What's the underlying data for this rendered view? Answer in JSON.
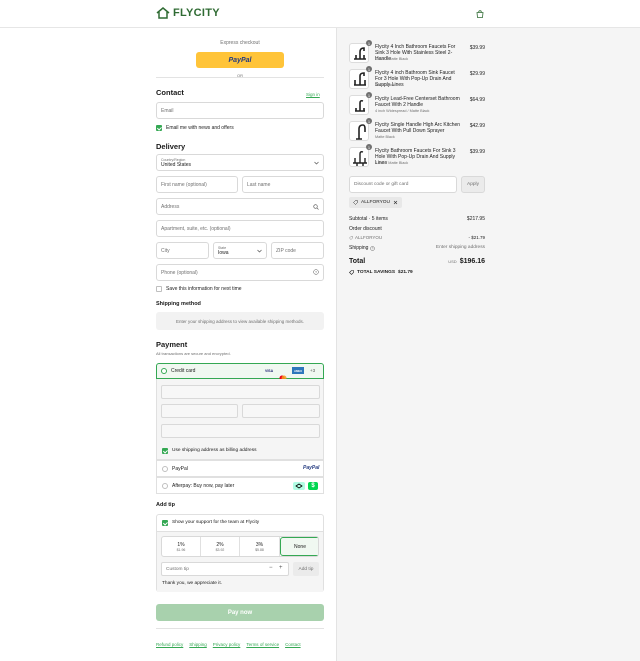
{
  "brand": {
    "name": "FLYCITY",
    "color": "#2f6b33",
    "accent": "#34a853"
  },
  "express": {
    "label": "Express checkout",
    "paypal_label": "PayPal",
    "or": "OR"
  },
  "contact": {
    "title": "Contact",
    "signin": "Sign in",
    "email_placeholder": "Email",
    "news_label": "Email me with news and offers",
    "news_checked": true
  },
  "delivery": {
    "title": "Delivery",
    "country_label": "Country/Region",
    "country_value": "United States",
    "first_name": "First name (optional)",
    "last_name": "Last name",
    "address": "Address",
    "apartment": "Apartment, suite, etc. (optional)",
    "city": "City",
    "state_label": "State",
    "state_value": "Iowa",
    "zip": "ZIP code",
    "phone": "Phone (optional)",
    "save_label": "Save this information for next time"
  },
  "shipping": {
    "title": "Shipping method",
    "message": "Enter your shipping address to view available shipping methods."
  },
  "payment": {
    "title": "Payment",
    "subtitle": "All transactions are secure and encrypted.",
    "credit_label": "Credit card",
    "cards": [
      "VISA",
      "MC",
      "AMEX"
    ],
    "more": "+3",
    "billing_label": "Use shipping address as billing address",
    "paypal_label": "PayPal",
    "paypal_logo": "PayPal",
    "afterpay_label": "Afterpay: Buy now, pay later"
  },
  "tip": {
    "title": "Add tip",
    "support_label": "Show your support for the team at Flycity",
    "options": [
      {
        "pct": "1%",
        "amt": "$1.96"
      },
      {
        "pct": "2%",
        "amt": "$3.92"
      },
      {
        "pct": "3%",
        "amt": "$5.88"
      }
    ],
    "none": "None",
    "custom_placeholder": "Custom tip",
    "minus": "−",
    "plus": "+",
    "add_label": "Add tip",
    "thanks": "Thank you, we appreciate it."
  },
  "pay_now": "Pay now",
  "footer": {
    "links": [
      "Refund policy",
      "Shipping",
      "Privacy policy",
      "Terms of service",
      "Contact"
    ]
  },
  "cart": {
    "items": [
      {
        "qty": "1",
        "name": "Flycity 4 Inch Bathroom Faucets For Sink 3 Hole With Stainless Steel 2-Handle",
        "variant": "4 inch / Matte Black",
        "price": "$39.99"
      },
      {
        "qty": "1",
        "name": "Flycity 4 inch Bathroom Sink Faucet For 3 Hole With Pop-Up Drain And Supply Lines",
        "variant": "Matte Black",
        "price": "$29.99"
      },
      {
        "qty": "1",
        "name": "Flycity Lead-Free Centerset Bathroom Faucet With 2 Handle",
        "variant": "4 inch Widespread / Matte Black",
        "price": "$64.99"
      },
      {
        "qty": "1",
        "name": "Flycity Single Handle High Arc Kitchen Faucet With Pull Down Sprayer",
        "variant": "Matte Black",
        "price": "$42.99"
      },
      {
        "qty": "1",
        "name": "Flycity Bathroom Faucets For Sink 3 Hole With Pop-Up Drain And Supply Lines",
        "variant": "4 inch / Matte Black",
        "price": "$39.99"
      }
    ],
    "discount_placeholder": "Discount code or gift card",
    "apply": "Apply",
    "code": "ALLFORYOU",
    "subtotal_label": "Subtotal · 5 items",
    "subtotal": "$217.95",
    "order_discount_label": "Order discount",
    "discount_code": "ALLFORYOU",
    "discount_amount": "- $21.79",
    "shipping_label": "Shipping",
    "shipping_value": "Enter shipping address",
    "total_label": "Total",
    "currency": "USD",
    "total": "$196.16",
    "savings_label": "TOTAL SAVINGS",
    "savings": "$21.79"
  }
}
